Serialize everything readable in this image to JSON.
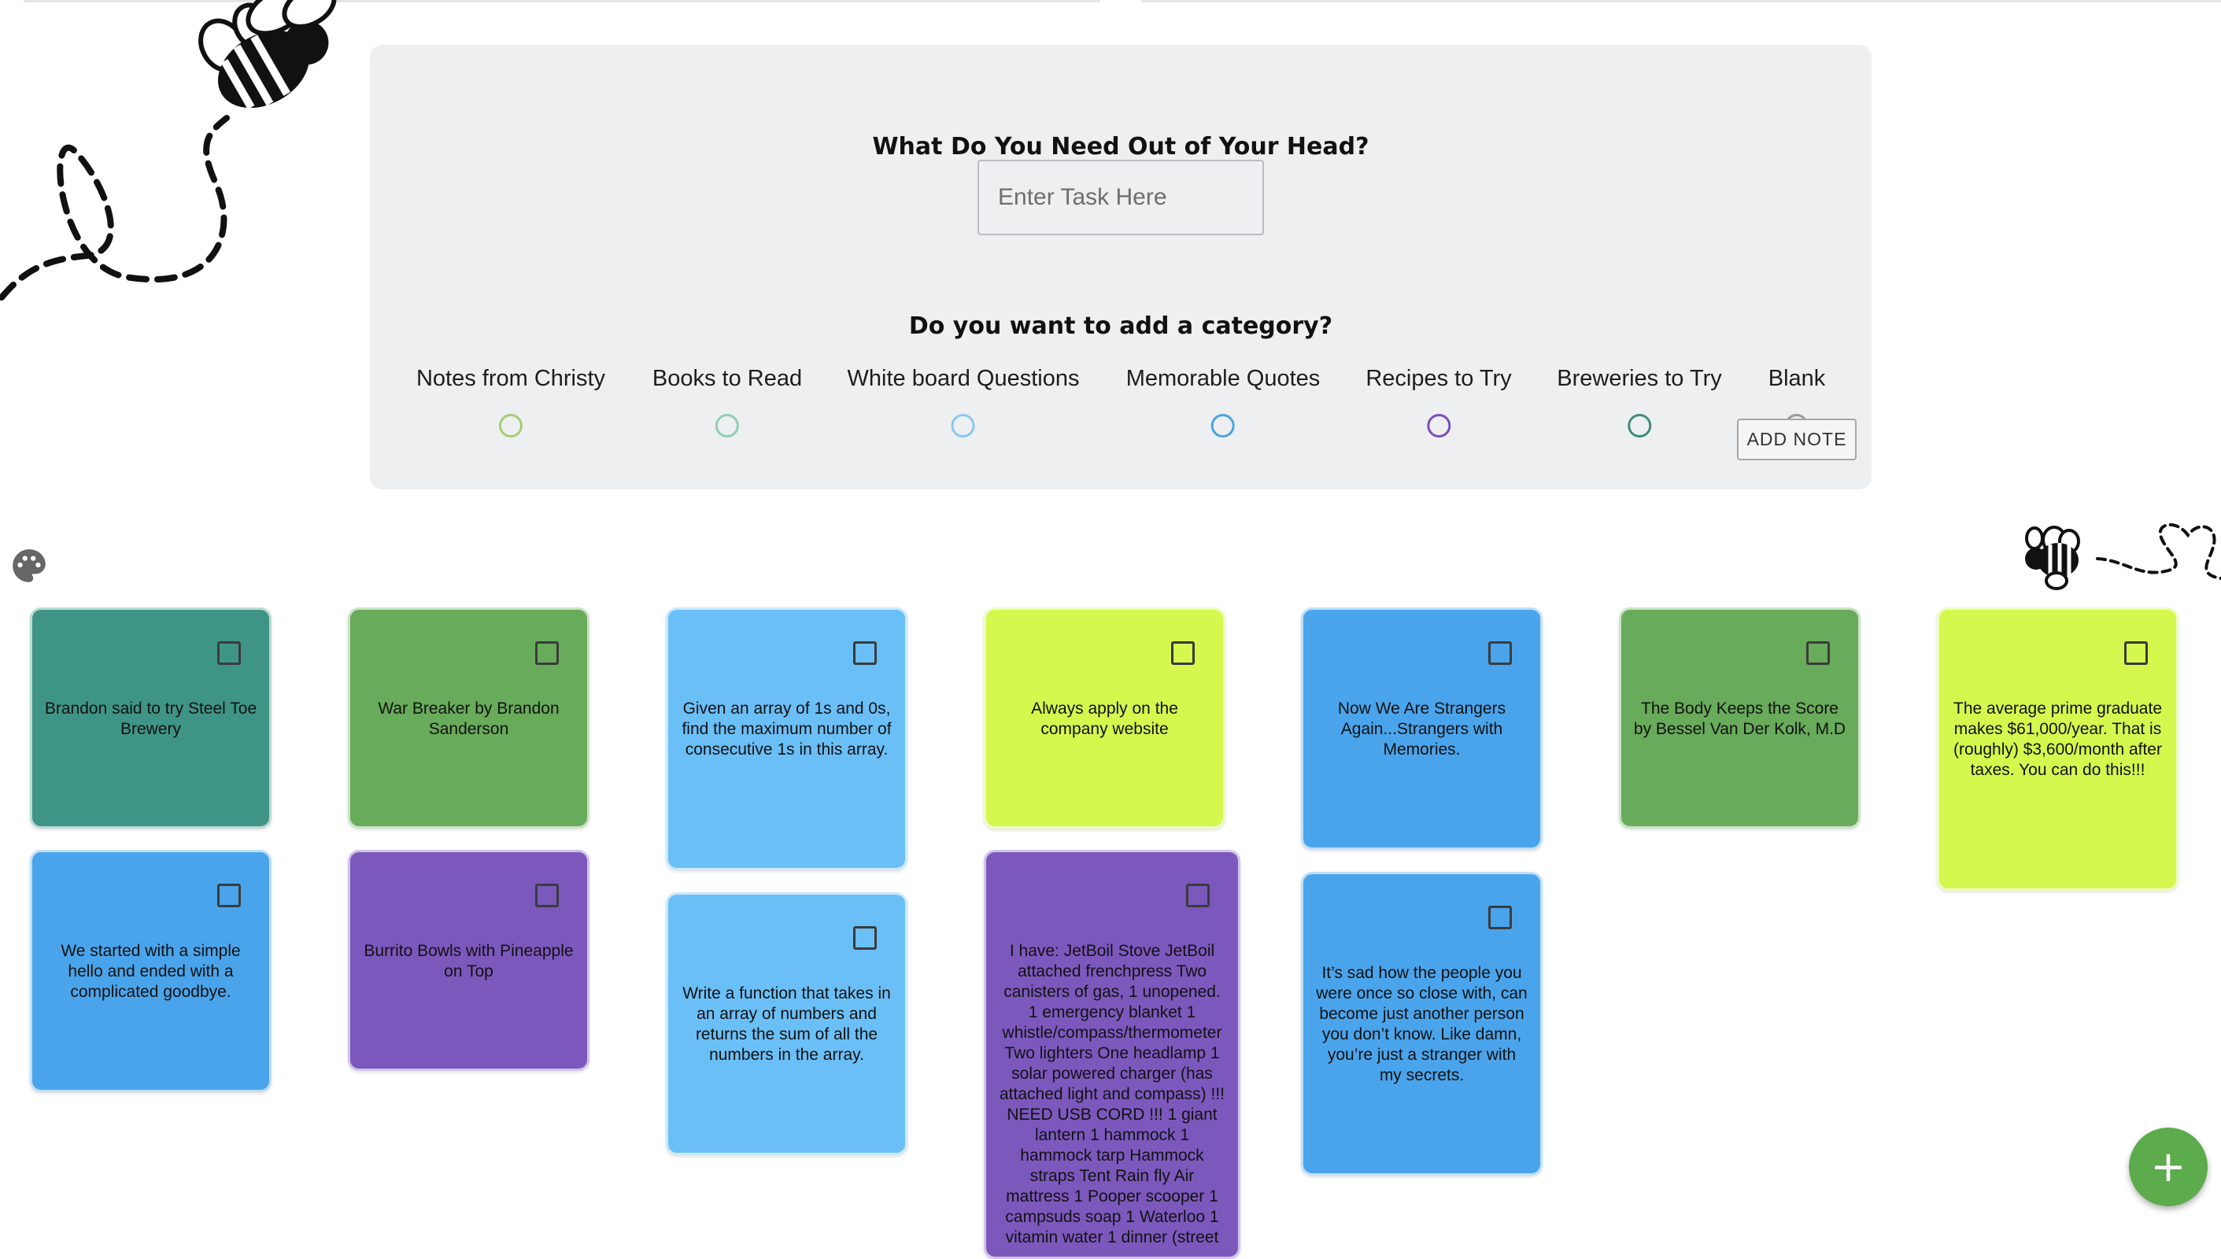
{
  "form": {
    "title": "What Do You Need Out of Your Head?",
    "task_placeholder": "Enter Task Here",
    "task_value": "",
    "category_question": "Do you want to add a category?",
    "categories": [
      {
        "label": "Notes from Christy",
        "color": "#a5cc72"
      },
      {
        "label": "Books to Read",
        "color": "#8fcfb4"
      },
      {
        "label": "White board Questions",
        "color": "#8cc7ee"
      },
      {
        "label": "Memorable Quotes",
        "color": "#4aa3e3"
      },
      {
        "label": "Recipes to Try",
        "color": "#7c4fbb"
      },
      {
        "label": "Breweries to Try",
        "color": "#3d8f7c"
      },
      {
        "label": "Blank",
        "color": "#999999"
      }
    ],
    "add_button": "ADD NOTE"
  },
  "icons": {
    "palette": "palette-icon",
    "bee_top": "bee-icon",
    "bee_right": "bee-heart-icon",
    "fab": "plus-icon"
  },
  "fab_label": "+",
  "notes": [
    {
      "text": "Brandon said to try Steel Toe Brewery",
      "color": "#3f9585"
    },
    {
      "text": "War Breaker by Brandon Sanderson",
      "color": "#68ab5a"
    },
    {
      "text": "Given an array of 1s and 0s, find the maximum number of consecutive 1s in this array.",
      "color": "#6bbff7"
    },
    {
      "text": "Always apply on the company website",
      "color": "#d4f84e"
    },
    {
      "text": "Now We Are Strangers Again...Strangers with Memories.",
      "color": "#4aa4eb"
    },
    {
      "text": "The Body Keeps the Score by Bessel Van Der Kolk, M.D",
      "color": "#68ab5a"
    },
    {
      "text": "The average prime graduate makes $61,000/year. That is (roughly) $3,600/month after taxes. You can do this!!!",
      "color": "#d4f84e"
    },
    {
      "text": "We started with a simple hello and ended with a complicated goodbye.",
      "color": "#4aa4eb"
    },
    {
      "text": "Burrito Bowls with Pineapple on Top",
      "color": "#7c58bd"
    },
    {
      "text": "Write a function that takes in an array of numbers and returns the sum of all the numbers in the array.",
      "color": "#6bbff7"
    },
    {
      "text": "I have: JetBoil Stove JetBoil attached frenchpress Two canisters of gas, 1 unopened. 1 emergency blanket 1 whistle/compass/thermometer Two lighters One headlamp 1 solar powered charger (has attached light and compass) !!! NEED USB CORD !!! 1 giant lantern 1 hammock 1 hammock tarp Hammock straps Tent Rain fly Air mattress 1 Pooper scooper 1 campsuds soap 1 Waterloo 1 vitamin water 1 dinner (street",
      "color": "#7c58bd"
    },
    {
      "text": "It’s sad how the people you were once so close with, can become just another person you don’t know. Like damn, you’re just a stranger with my secrets.",
      "color": "#4aa4eb"
    }
  ]
}
